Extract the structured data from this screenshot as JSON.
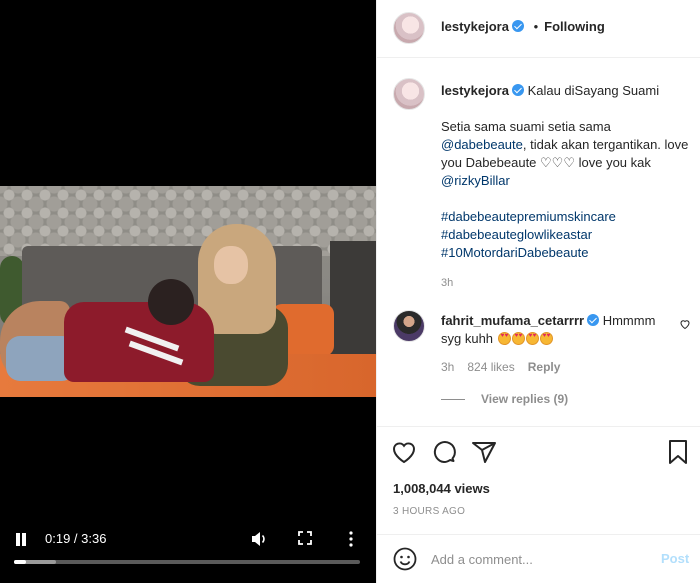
{
  "video": {
    "time": "0:19 / 3:36",
    "progress_fraction": 0.035,
    "buffered_fraction": 0.12
  },
  "header": {
    "username": "lestykejora",
    "separator": "•",
    "follow_status": "Following"
  },
  "caption": {
    "username": "lestykejora",
    "title": "Kalau diSayang Suami",
    "line1_prefix": "Setia sama suami setia sama",
    "mention1": "@dabebeaute",
    "line1_suffix": ", tidak akan tergantikan. love you Dabebeaute ",
    "hearts": "♡♡♡",
    "line2": " love you kak ",
    "mention2": "@rizkyBillar",
    "hashtags": [
      "#dabebeautepremiumskincare",
      "#dabebeauteglowlikeastar",
      "#10MotordariDabebeaute"
    ],
    "time": "3h"
  },
  "comment": {
    "username": "fahrit_mufama_cetarrrr",
    "text": "Hmmmm syg kuhh",
    "time": "3h",
    "likes": "824 likes",
    "reply_label": "Reply",
    "view_replies": "View replies (9)"
  },
  "stats": {
    "views": "1,008,044 views",
    "posted_ago": "3 HOURS AGO"
  },
  "add_comment": {
    "placeholder": "Add a comment...",
    "post_label": "Post"
  },
  "colors": {
    "verified": "#3897f0",
    "link": "#00376b",
    "post_disabled": "#b2dffc"
  },
  "icons": [
    "pause-icon",
    "volume-icon",
    "fullscreen-icon",
    "more-options-icon",
    "heart-icon",
    "comment-icon",
    "share-icon",
    "bookmark-icon",
    "smiley-icon",
    "verified-badge-icon"
  ]
}
